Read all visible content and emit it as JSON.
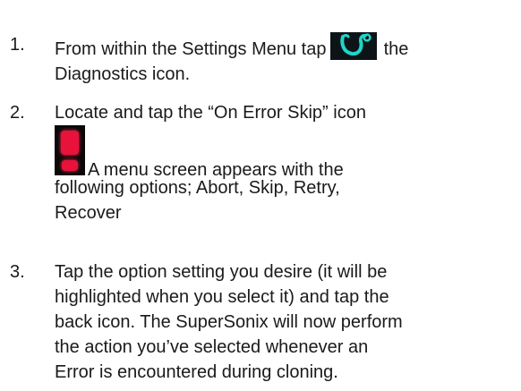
{
  "steps": [
    {
      "number": "1.",
      "line1_before_icon": "From within the Settings Menu tap",
      "icon": "stethoscope-icon",
      "line1_after_icon": "the",
      "line2": "Diagnostics icon."
    },
    {
      "number": "2.",
      "line1": "Locate and tap the “On Error Skip” icon",
      "icon": "exclamation-icon",
      "line2_after_icon": "A menu screen appears with the",
      "line3": "following options; Abort, Skip, Retry,",
      "line4": "Recover"
    },
    {
      "number": "3.",
      "lines": [
        "Tap the option setting you desire (it will be",
        "highlighted when you select it) and tap the",
        "back icon. The SuperSonix will now perform",
        "the action you’ve selected whenever an",
        "Error is encountered during cloning."
      ]
    }
  ],
  "colors": {
    "text": "#1a1a1a",
    "diagnostics_icon_bg": "#0d1418",
    "diagnostics_icon_stroke": "#1fd6c8",
    "error_icon_bg": "#0b0808",
    "error_icon_red": "#e8123a"
  }
}
